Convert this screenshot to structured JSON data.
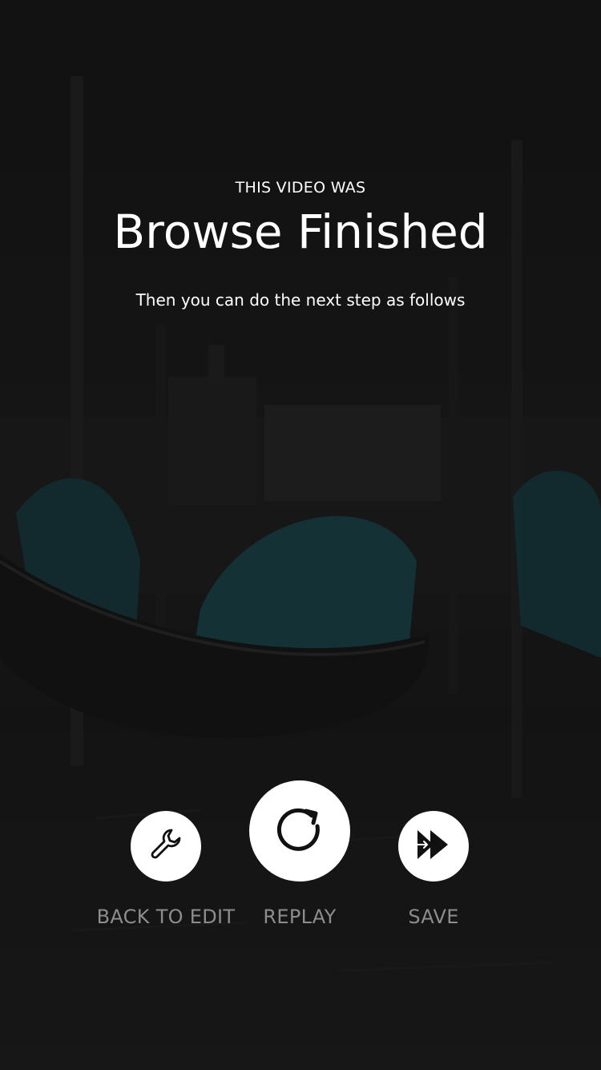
{
  "header": {
    "eyebrow": "THIS VIDEO WAS",
    "title": "Browse Finished",
    "subtitle": "Then you can do the next step as follows"
  },
  "actions": [
    {
      "label": "BACK TO EDIT",
      "icon": "wrench-icon"
    },
    {
      "label": "REPLAY",
      "icon": "replay-icon"
    },
    {
      "label": "SAVE",
      "icon": "fast-forward-icon"
    }
  ],
  "colors": {
    "background": "#141414",
    "text": "#ffffff",
    "label": "#8d8d8d",
    "button": "#ffffff",
    "icon": "#111111",
    "cover_teal": "#17424a"
  }
}
